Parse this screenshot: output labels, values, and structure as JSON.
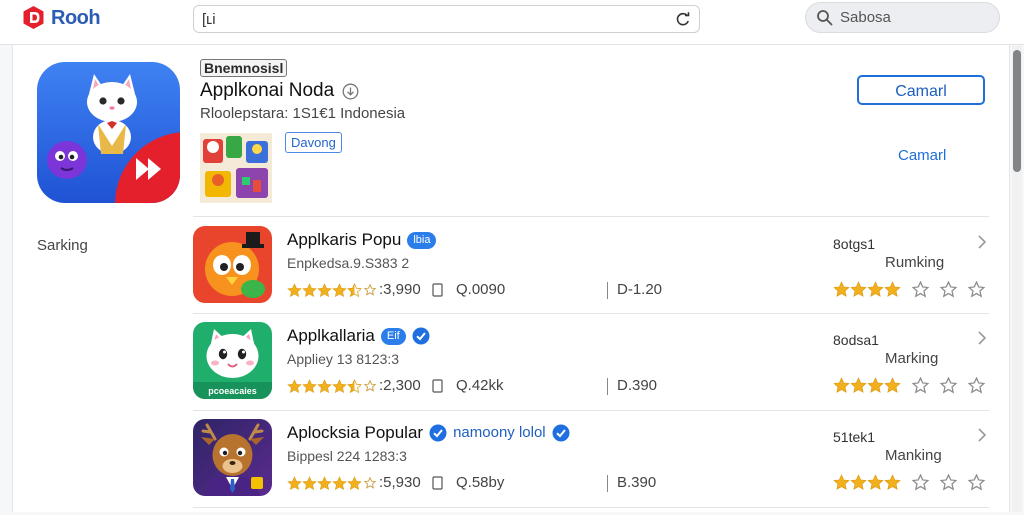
{
  "app": {
    "logo_text": "Rooh"
  },
  "search": {
    "value": "[ʟi"
  },
  "quick_search": {
    "placeholder": "Sabosa"
  },
  "featured": {
    "label": "Bnemnosisl",
    "title": "Applkonai Noda",
    "subtitle": "Rloolepstara: 1S1€1 Indonesia",
    "tag": "Davong",
    "primary_button": "Camarl",
    "link": "Camarl"
  },
  "sidebar": {
    "label": "Sarking"
  },
  "list": [
    {
      "title": "Applkaris Popu",
      "badge": "lbia",
      "subtitle": "Enpkedsa.9.S383 2",
      "rating": 4.5,
      "reviews": ":3,990",
      "downloads": "Q.0090",
      "size": "D-1.20",
      "rank": "8otgs1",
      "rank_label": "Rumking",
      "rank_stars": {
        "filled": 4,
        "total": 7
      }
    },
    {
      "title": "Applkallaria",
      "badge": "Eif",
      "verified": true,
      "subtitle": "Appliey 13 8123:3",
      "rating": 4.5,
      "reviews": ":2,300",
      "downloads": "Q.42kk",
      "size": "D.390",
      "rank": "8odsa1",
      "rank_label": "Marking",
      "rank_stars": {
        "filled": 4,
        "total": 7
      },
      "icon_text": "pcoeacaies"
    },
    {
      "title": "Aplocksia Popular",
      "verified": true,
      "developer": "namoony lolol",
      "developer_verified": true,
      "subtitle": "Bippesl 224 1283:3",
      "rating": 5,
      "reviews": ":5,930",
      "downloads": "Q.58by",
      "size": "B.390",
      "rank": "51tek1",
      "rank_label": "Manking",
      "rank_stars": {
        "filled": 4,
        "total": 7
      }
    }
  ],
  "colors": {
    "accent": "#1e6fd9",
    "brand": "#e3202b",
    "star": "#f2b01e",
    "star_empty": "#8d8d8d",
    "badge": "#2b7de9"
  },
  "icons": {
    "logo": "logo-icon",
    "search_action": "refresh-icon",
    "quick_search": "search-icon",
    "title_info": "circle-down-icon",
    "verified": "verified-check-icon",
    "file": "file-icon",
    "row_action": "chevron-right-icon"
  }
}
